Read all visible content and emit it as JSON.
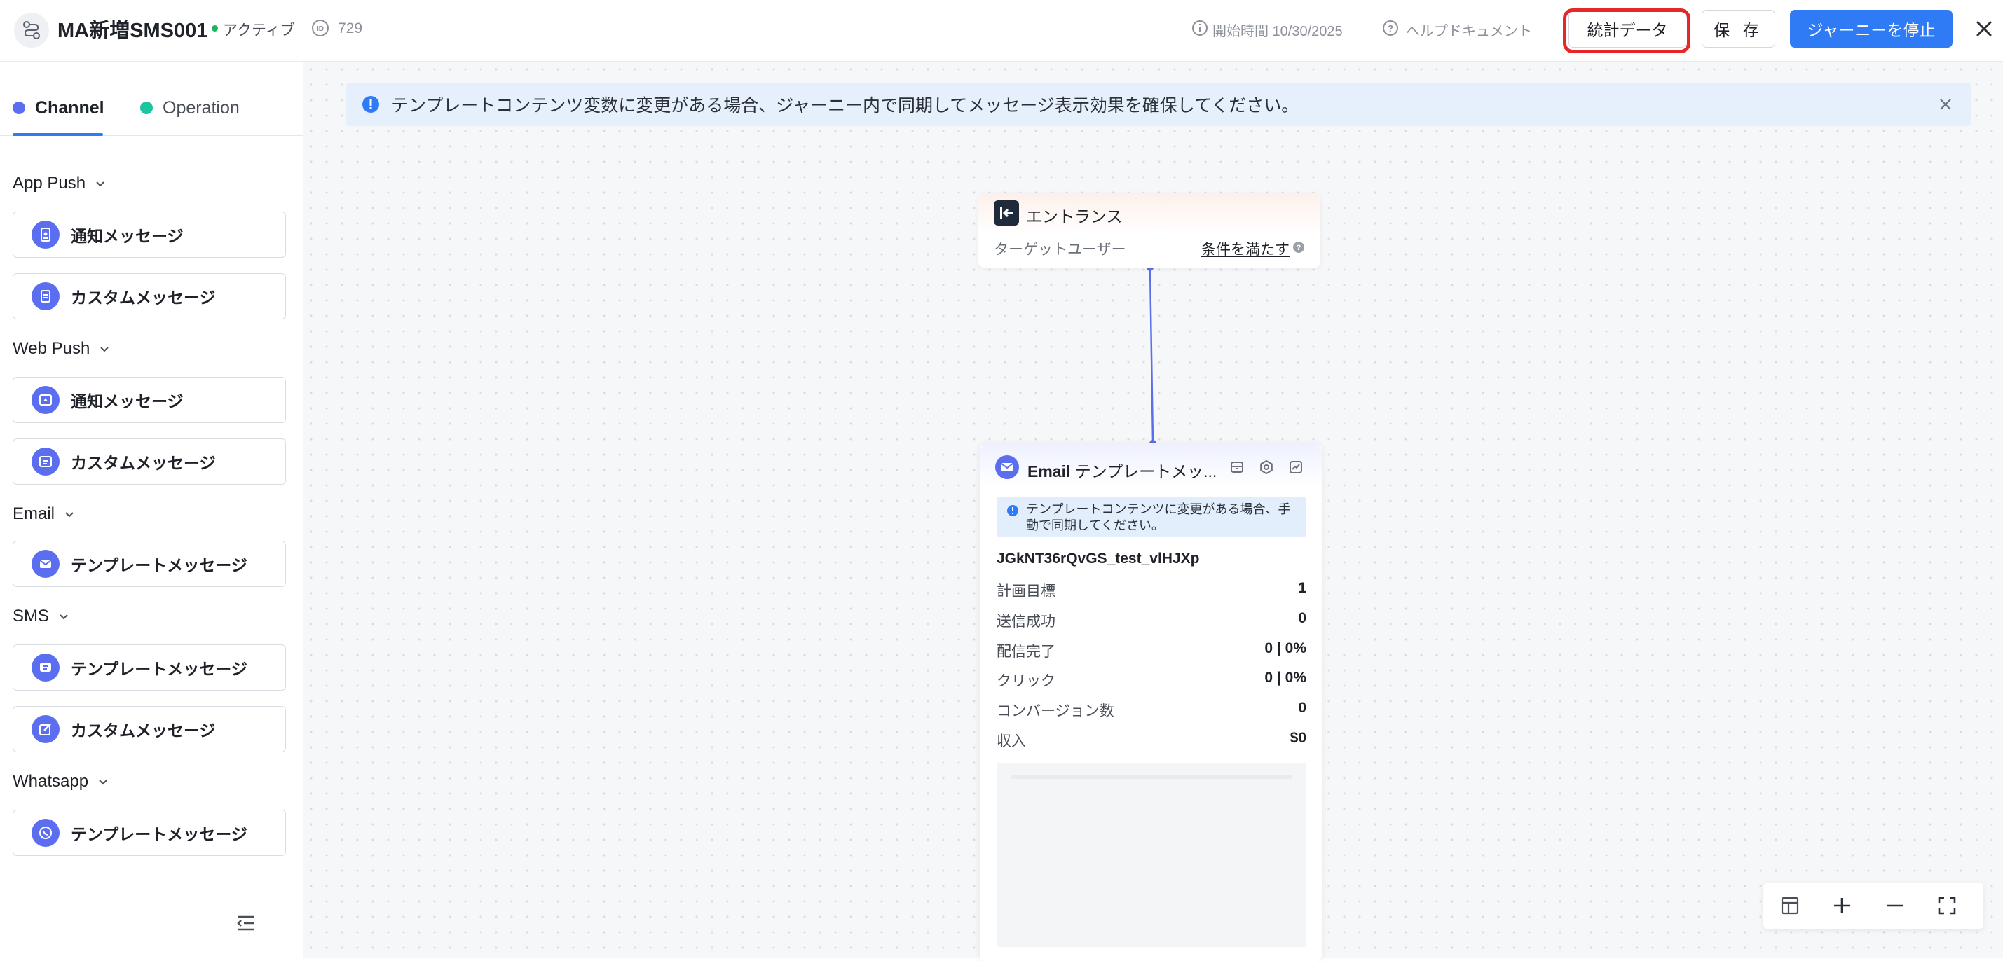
{
  "header": {
    "title": "MA新増SMS001",
    "status": "アクティブ",
    "id": "729",
    "start_time": "開始時間 10/30/2025",
    "help": "ヘルプドキュメント",
    "stats_button": "統計データ",
    "save_button": "保 存",
    "stop_button": "ジャーニーを停止"
  },
  "sidebar": {
    "tabs": [
      {
        "label": "Channel",
        "color": "#5b6ef0"
      },
      {
        "label": "Operation",
        "color": "#19c6a0"
      }
    ],
    "groups": [
      {
        "label": "App Push",
        "items": [
          "通知メッセージ",
          "カスタムメッセージ"
        ]
      },
      {
        "label": "Web Push",
        "items": [
          "通知メッセージ",
          "カスタムメッセージ"
        ]
      },
      {
        "label": "Email",
        "items": [
          "テンプレートメッセージ"
        ]
      },
      {
        "label": "SMS",
        "items": [
          "テンプレートメッセージ",
          "カスタムメッセージ"
        ]
      },
      {
        "label": "Whatsapp",
        "items": [
          "テンプレートメッセージ"
        ]
      }
    ]
  },
  "canvas": {
    "banner": "テンプレートコンテンツ変数に変更がある場合、ジャーニー内で同期してメッセージ表示効果を確保してください。",
    "entrance": {
      "title": "エントランス",
      "target_label": "ターゲットユーザー",
      "condition_link": "条件を満たす"
    },
    "email_node": {
      "title_bold": "Email",
      "title_rest": "テンプレートメッ...",
      "alert": "テンプレートコンテンツに変更がある場合、手動で同期してください。",
      "template_name": "JGkNT36rQvGS_test_vlHJXp",
      "stats": [
        {
          "label": "計画目標",
          "value": "1"
        },
        {
          "label": "送信成功",
          "value": "0"
        },
        {
          "label": "配信完了",
          "value": "0 | 0%"
        },
        {
          "label": "クリック",
          "value": "0 | 0%"
        },
        {
          "label": "コンバージョン数",
          "value": "0"
        },
        {
          "label": "収入",
          "value": "$0"
        }
      ]
    }
  },
  "colors": {
    "accent": "#2f7bf5",
    "node_icon": "#5b6ef0",
    "status_active": "#22b35e",
    "highlight": "#e5262a"
  }
}
